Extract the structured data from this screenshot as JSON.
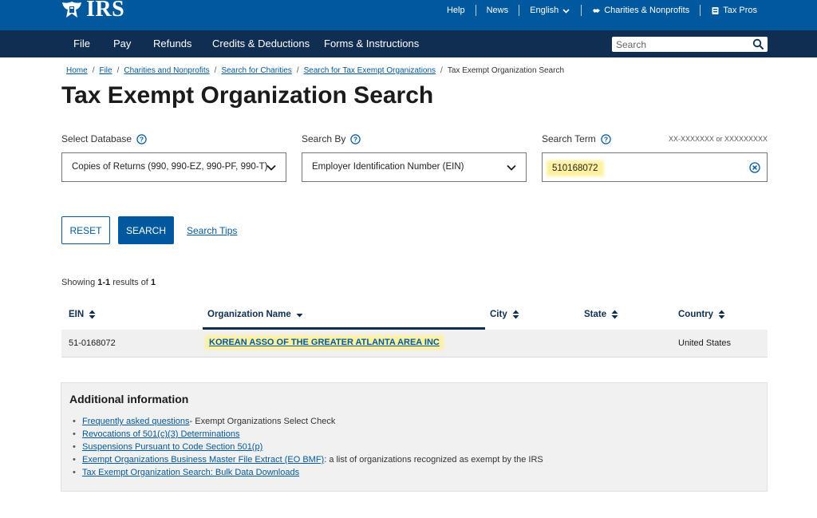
{
  "header": {
    "logo_text": "IRS",
    "links": [
      {
        "label": "Help",
        "icon": ""
      },
      {
        "label": "News",
        "icon": ""
      },
      {
        "label": "English",
        "icon": "chevron-down-icon"
      },
      {
        "label": "Charities & Nonprofits",
        "icon": "handshake-icon"
      },
      {
        "label": "Tax Pros",
        "icon": "id-card-icon"
      }
    ]
  },
  "nav": {
    "items": [
      "File",
      "Pay",
      "Refunds",
      "Credits & Deductions",
      "Forms & Instructions"
    ],
    "search_placeholder": "Search"
  },
  "breadcrumb": {
    "links": [
      "Home",
      "File",
      "Charities and Nonprofits",
      "Search for Charities",
      "Search for Tax Exempt Organizations"
    ],
    "current": "Tax Exempt Organization Search"
  },
  "page_title": "Tax Exempt Organization Search",
  "form": {
    "database_label": "Select Database",
    "database_value": "Copies of Returns (990, 990-EZ, 990-PF, 990-T)",
    "search_by_label": "Search By",
    "search_by_value": "Employer Identification Number (EIN)",
    "search_term_label": "Search Term",
    "search_term_hint": "XX-XXXXXXX or XXXXXXXXX",
    "search_term_value": "510168072"
  },
  "buttons": {
    "reset": "RESET",
    "search": "SEARCH",
    "tips": "Search Tips"
  },
  "results": {
    "showing": "Showing",
    "range": "1-1",
    "results_of": "results of",
    "total": "1",
    "columns": [
      "EIN",
      "Organization Name",
      "City",
      "State",
      "Country"
    ],
    "rows": [
      {
        "ein": "51-0168072",
        "name": "KOREAN ASSO OF THE GREATER ATLANTA AREA INC",
        "city": "",
        "state": "",
        "country": "United States"
      }
    ]
  },
  "additional_info": {
    "title": "Additional information",
    "items": [
      {
        "link": "Frequently asked questions",
        "text": " - Exempt Organizations Select Check"
      },
      {
        "link": "Revocations of 501(c)(3) Determinations",
        "text": ""
      },
      {
        "link": "Suspensions Pursuant to Code Section 501(p)",
        "text": ""
      },
      {
        "link": "Exempt Organizations Business Master File Extract (EO BMF)",
        "text": ": a list of organizations recognized as exempt by the IRS"
      },
      {
        "link": "Tax Exempt Organization Search: Bulk Data Downloads",
        "text": ""
      }
    ]
  },
  "colors": {
    "utility_bar": "#00599c",
    "main_nav": "#0f2e52",
    "link": "#00599c",
    "highlight": "#fdf1a0"
  }
}
